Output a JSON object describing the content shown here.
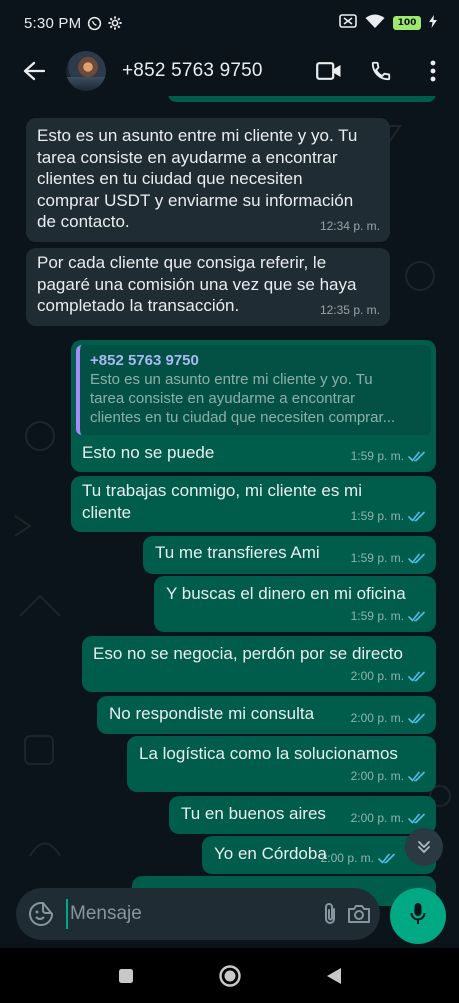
{
  "status_bar": {
    "time": "5:30 PM",
    "battery": "100"
  },
  "header": {
    "contact_name": "+852 5763 9750"
  },
  "messages": [
    {
      "text": "Esto es un asunto entre mi cliente y yo. Tu\ntarea consiste en ayudarme a encontrar\nclientes en tu ciudad que necesiten\ncomprar USDT y enviarme su información\nde contacto.",
      "time": "12:34 p. m."
    },
    {
      "text": "Por cada cliente que consiga referir, le\npagaré una comisión una vez que se haya\ncompletado la transacción.",
      "time": "12:35 p. m."
    },
    {
      "quote": {
        "author": "+852 5763 9750",
        "line1": "Esto es un asunto entre mi cliente y yo. Tu",
        "line2": "tarea consiste en ayudarme a encontrar",
        "line3": "clientes en tu ciudad que necesiten comprar..."
      },
      "text": "Esto no se puede",
      "time": "1:59 p. m."
    },
    {
      "text": "Tu trabajas conmigo, mi cliente es mi\ncliente",
      "time": "1:59 p. m."
    },
    {
      "text": "Tu me transfieres Ami",
      "time": "1:59 p. m."
    },
    {
      "text": "Y buscas el dinero en mi oficina",
      "time": "1:59 p. m."
    },
    {
      "text": "Eso no se negocia, perdón por se directo",
      "time": "2:00 p. m."
    },
    {
      "text": "No respondiste mi consulta",
      "time": "2:00 p. m."
    },
    {
      "text": "La logística como la solucionamos",
      "time": "2:00 p. m."
    },
    {
      "text": "Tu en buenos aires",
      "time": "2:00 p. m."
    },
    {
      "text": "Yo en Córdoba",
      "time": "2:00 p. m."
    }
  ],
  "composer": {
    "placeholder": "Mensaje"
  },
  "colors": {
    "background": "#0b141a",
    "incoming_bubble": "#202c33",
    "outgoing_bubble": "#005c4b",
    "accent": "#00a884",
    "read_ticks": "#53bdeb"
  }
}
